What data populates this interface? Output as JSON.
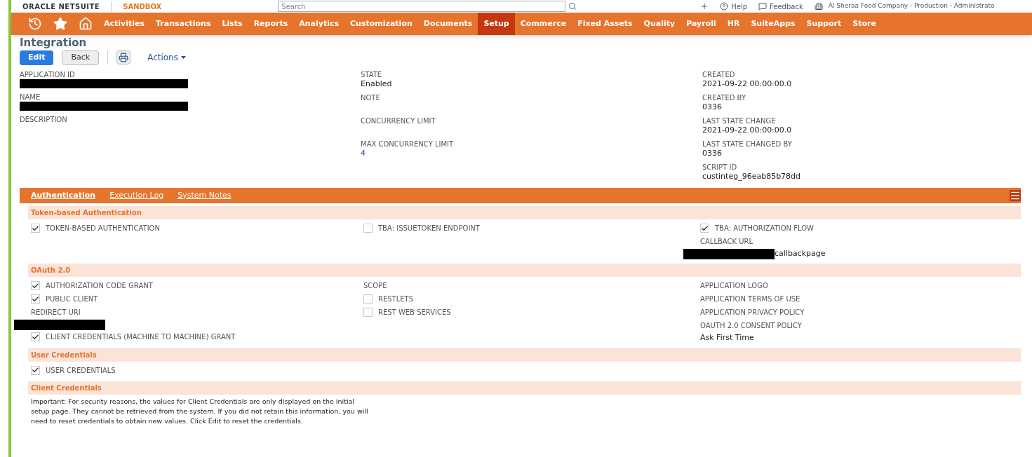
{
  "header": {
    "logo": "ORACLE NETSUITE",
    "environment": "SANDBOX",
    "search_placeholder": "Search",
    "links": [
      "Help",
      "Feedback"
    ],
    "account": "Al Sheraa Food Company - Production - Administrato"
  },
  "nav": [
    {
      "kind": "recent",
      "selected": false
    },
    {
      "kind": "star",
      "selected": false
    },
    {
      "kind": "home",
      "selected": false
    },
    {
      "kind": "text",
      "label": "Activities",
      "selected": false
    },
    {
      "kind": "text",
      "label": "Transactions",
      "selected": false
    },
    {
      "kind": "text",
      "label": "Lists",
      "selected": false
    },
    {
      "kind": "text",
      "label": "Reports",
      "selected": false
    },
    {
      "kind": "text",
      "label": "Analytics",
      "selected": false
    },
    {
      "kind": "text",
      "label": "Customization",
      "selected": false
    },
    {
      "kind": "text",
      "label": "Documents",
      "selected": false
    },
    {
      "kind": "text",
      "label": "Setup",
      "selected": true
    },
    {
      "kind": "text",
      "label": "Commerce",
      "selected": false
    },
    {
      "kind": "text",
      "label": "Fixed Assets",
      "selected": false
    },
    {
      "kind": "text",
      "label": "Quality",
      "selected": false
    },
    {
      "kind": "text",
      "label": "Payroll",
      "selected": false
    },
    {
      "kind": "text",
      "label": "HR",
      "selected": false
    },
    {
      "kind": "text",
      "label": "SuiteApps",
      "selected": false
    },
    {
      "kind": "text",
      "label": "Support",
      "selected": false
    },
    {
      "kind": "text",
      "label": "Store",
      "selected": false
    }
  ],
  "page_title": "Integration",
  "toolbar": {
    "buttons": [
      {
        "label": "Edit",
        "primary": true
      },
      {
        "label": "Back",
        "primary": false
      }
    ],
    "actions": "Actions"
  },
  "fields": [
    [
      {
        "label": "APPLICATION ID",
        "kind": "redacted"
      },
      {
        "label": "NAME",
        "kind": "redacted"
      },
      {
        "label": "DESCRIPTION",
        "kind": "empty"
      }
    ],
    [
      {
        "label": "STATE",
        "kind": "text",
        "value": "Enabled"
      },
      {
        "label": "NOTE",
        "kind": "empty"
      },
      {
        "label": "CONCURRENCY LIMIT",
        "kind": "empty"
      },
      {
        "label": "MAX CONCURRENCY LIMIT",
        "kind": "link",
        "value": "4"
      }
    ],
    [
      {
        "label": "CREATED",
        "kind": "text",
        "value": "2021-09-22 00:00:00.0"
      },
      {
        "label": "CREATED BY",
        "kind": "text",
        "value": "0336"
      },
      {
        "label": "LAST STATE CHANGE",
        "kind": "text",
        "value": "2021-09-22 00:00:00.0"
      },
      {
        "label": "LAST STATE CHANGED BY",
        "kind": "text",
        "value": "0336"
      },
      {
        "label": "SCRIPT ID",
        "kind": "text",
        "value": "custinteg_96eab85b78dd"
      }
    ]
  ],
  "tabs": [
    {
      "label": "Authentication",
      "selected": true
    },
    {
      "label": "Execution Log",
      "selected": false
    },
    {
      "label": "System Notes",
      "selected": false
    }
  ],
  "sections": [
    {
      "title": "Token-based Authentication",
      "columns": [
        [
          {
            "kind": "checkbox",
            "label": "TOKEN-BASED AUTHENTICATION",
            "checked": true
          }
        ],
        [
          {
            "kind": "checkbox",
            "label": "TBA: ISSUETOKEN ENDPOINT",
            "checked": false
          }
        ],
        [
          {
            "kind": "checkbox",
            "label": "TBA: AUTHORIZATION FLOW",
            "checked": true
          },
          {
            "kind": "label",
            "label": "CALLBACK URL"
          },
          {
            "kind": "redacted_value",
            "value": "callbackpage"
          }
        ]
      ]
    },
    {
      "title": "OAuth 2.0",
      "columns": [
        [
          {
            "kind": "checkbox",
            "label": "AUTHORIZATION CODE GRANT",
            "checked": true
          },
          {
            "kind": "checkbox",
            "label": "PUBLIC CLIENT",
            "checked": true
          },
          {
            "kind": "label",
            "label": "REDIRECT URI"
          },
          {
            "kind": "redacted_value"
          },
          {
            "kind": "checkbox",
            "label": "CLIENT CREDENTIALS (MACHINE TO MACHINE) GRANT",
            "checked": true
          }
        ],
        [
          {
            "kind": "label",
            "label": "SCOPE"
          },
          {
            "kind": "checkbox",
            "label": "RESTLETS",
            "checked": false
          },
          {
            "kind": "checkbox",
            "label": "REST WEB SERVICES",
            "checked": false
          }
        ],
        [
          {
            "kind": "label",
            "label": "APPLICATION LOGO"
          },
          {
            "kind": "label",
            "label": "APPLICATION TERMS OF USE"
          },
          {
            "kind": "label",
            "label": "APPLICATION PRIVACY POLICY"
          },
          {
            "kind": "label",
            "label": "OAUTH 2.0 CONSENT POLICY"
          },
          {
            "kind": "value",
            "value": "Ask First Time"
          }
        ]
      ]
    },
    {
      "title": "User Credentials",
      "columns": [
        [
          {
            "kind": "checkbox",
            "label": "USER CREDENTIALS",
            "checked": true
          }
        ]
      ]
    },
    {
      "title": "Client Credentials",
      "columns": [
        [
          {
            "kind": "paragraph",
            "value": "Important: For security reasons, the values for Client Credentials are only displayed on the initial setup page. They cannot be retrieved from the system. If you did not retain this information, you will need to reset credentials to obtain new values. Click Edit to reset the credentials."
          }
        ]
      ]
    }
  ]
}
